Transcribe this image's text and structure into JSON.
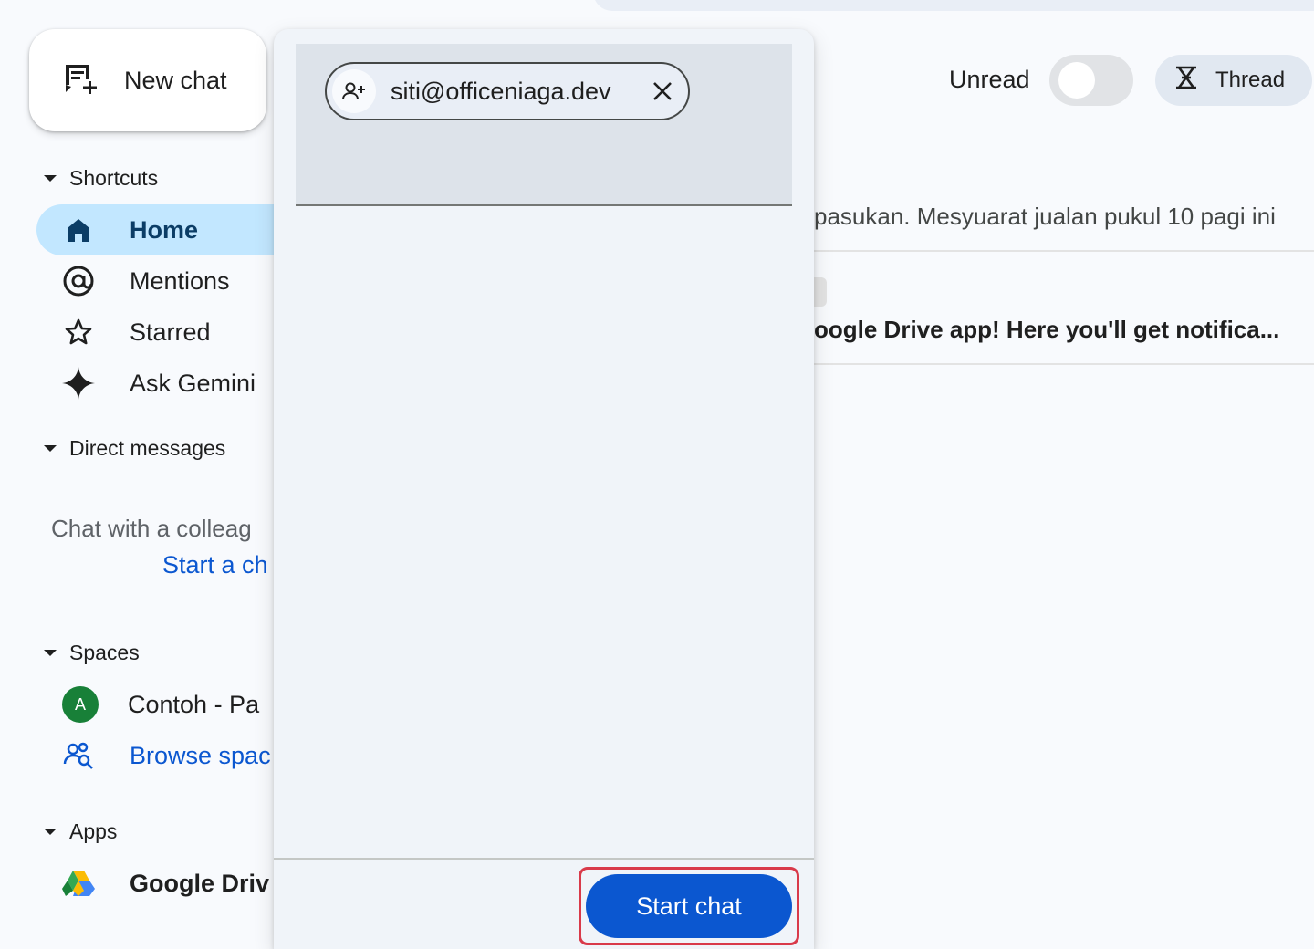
{
  "header": {
    "new_chat_label": "New chat",
    "unread_label": "Unread",
    "unread_on": false,
    "thread_label": "Thread"
  },
  "sidebar": {
    "shortcuts": {
      "title": "Shortcuts",
      "items": [
        {
          "label": "Home",
          "icon": "home-icon",
          "active": true
        },
        {
          "label": "Mentions",
          "icon": "at-icon"
        },
        {
          "label": "Starred",
          "icon": "star-icon"
        },
        {
          "label": "Ask Gemini",
          "icon": "gemini-sparkle-icon"
        }
      ]
    },
    "direct_messages": {
      "title": "Direct messages",
      "empty_text": "Chat with a colleag",
      "start_link": "Start a ch"
    },
    "spaces": {
      "title": "Spaces",
      "items": [
        {
          "label": "Contoh - Pa",
          "avatar_letter": "A"
        },
        {
          "label": "Browse spac",
          "icon": "browse-spaces-icon"
        }
      ]
    },
    "apps": {
      "title": "Apps",
      "items": [
        {
          "label": "Google Driv",
          "icon": "google-drive-icon"
        }
      ]
    }
  },
  "main": {
    "rows": [
      {
        "text": "pasukan. Mesyuarat jualan pukul 10 pagi ini"
      },
      {
        "text": "oogle Drive app! Here you'll get notifica..."
      }
    ]
  },
  "dialog": {
    "recipient_chip": "siti@officeniaga.dev",
    "start_button": "Start chat"
  },
  "colors": {
    "accent": "#0b57d0",
    "active_nav": "#c2e7ff",
    "highlight": "#d93a4a"
  }
}
